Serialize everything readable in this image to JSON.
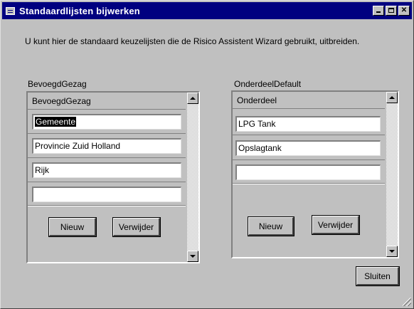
{
  "window": {
    "title": "Standaardlijsten bijwerken",
    "colors": {
      "titlebar": "#000080",
      "face": "#c0c0c0"
    }
  },
  "intro_text": "U kunt hier de standaard keuzelijsten die de Risico Assistent Wizard gebruikt, uitbreiden.",
  "left_panel": {
    "section_label": "BevoegdGezag",
    "column_header": "BevoegdGezag",
    "rows": [
      "Gemeente",
      "Provincie Zuid Holland",
      "Rijk",
      ""
    ],
    "new_button": "Nieuw",
    "delete_button": "Verwijder"
  },
  "right_panel": {
    "section_label": "OnderdeelDefault",
    "column_header": "Onderdeel",
    "rows": [
      "LPG Tank",
      "Opslagtank",
      ""
    ],
    "new_button": "Nieuw",
    "delete_button": "Verwijder"
  },
  "close_button": "Sluiten",
  "icons": [
    "app-icon",
    "minimize-icon",
    "maximize-icon",
    "close-icon",
    "scroll-up-icon",
    "scroll-down-icon",
    "resize-grip-icon"
  ]
}
